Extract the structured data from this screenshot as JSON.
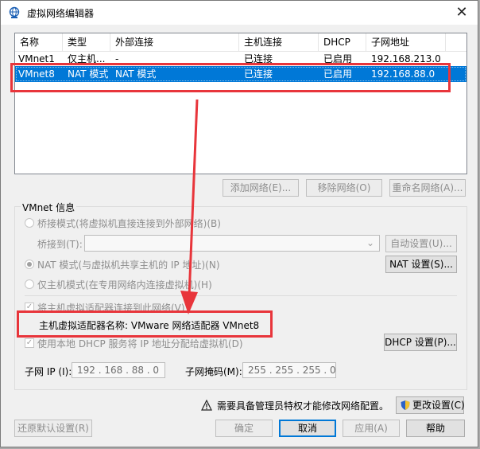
{
  "window": {
    "title": "虚拟网络编辑器"
  },
  "table": {
    "headers": [
      "名称",
      "类型",
      "外部连接",
      "主机连接",
      "DHCP",
      "子网地址"
    ],
    "rows": [
      {
        "name": "VMnet1",
        "type": "仅主机...",
        "external": "-",
        "host": "已连接",
        "dhcp": "已启用",
        "subnet": "192.168.213.0"
      },
      {
        "name": "VMnet8",
        "type": "NAT 模式",
        "external": "NAT 模式",
        "host": "已连接",
        "dhcp": "已启用",
        "subnet": "192.168.88.0"
      }
    ]
  },
  "list_buttons": {
    "add": "添加网络(E)...",
    "remove": "移除网络(O)",
    "rename": "重命名网络(A)..."
  },
  "vmnet_info": {
    "title": "VMnet 信息",
    "bridge_mode": "桥接模式(将虚拟机直接连接到外部网络)(B)",
    "bridge_to_label": "桥接到(T):",
    "auto_settings": "自动设置(U)...",
    "nat_mode": "NAT 模式(与虚拟机共享主机的 IP 地址)(N)",
    "nat_settings": "NAT 设置(S)...",
    "host_only_mode": "仅主机模式(在专用网络内连接虚拟机)(H)",
    "connect_adapter": "将主机虚拟适配器连接到此网络(V)",
    "adapter_name": "主机虚拟适配器名称: VMware 网络适配器 VMnet8",
    "use_dhcp": "使用本地 DHCP 服务将 IP 地址分配给虚拟机(D)",
    "dhcp_settings": "DHCP 设置(P)...",
    "subnet_ip_label": "子网 IP (I):",
    "subnet_ip_value": "192 . 168 . 88 . 0",
    "subnet_mask_label": "子网掩码(M):",
    "subnet_mask_value": "255 . 255 . 255 . 0"
  },
  "footer": {
    "admin_notice": "需要具备管理员特权才能修改网络配置。",
    "change_settings": "更改设置(C)",
    "restore_defaults": "还原默认设置(R)",
    "ok": "确定",
    "cancel": "取消",
    "apply": "应用(A)",
    "help": "帮助"
  },
  "accent_colors": {
    "selection": "#0078d7",
    "annotation": "#e8353b"
  }
}
